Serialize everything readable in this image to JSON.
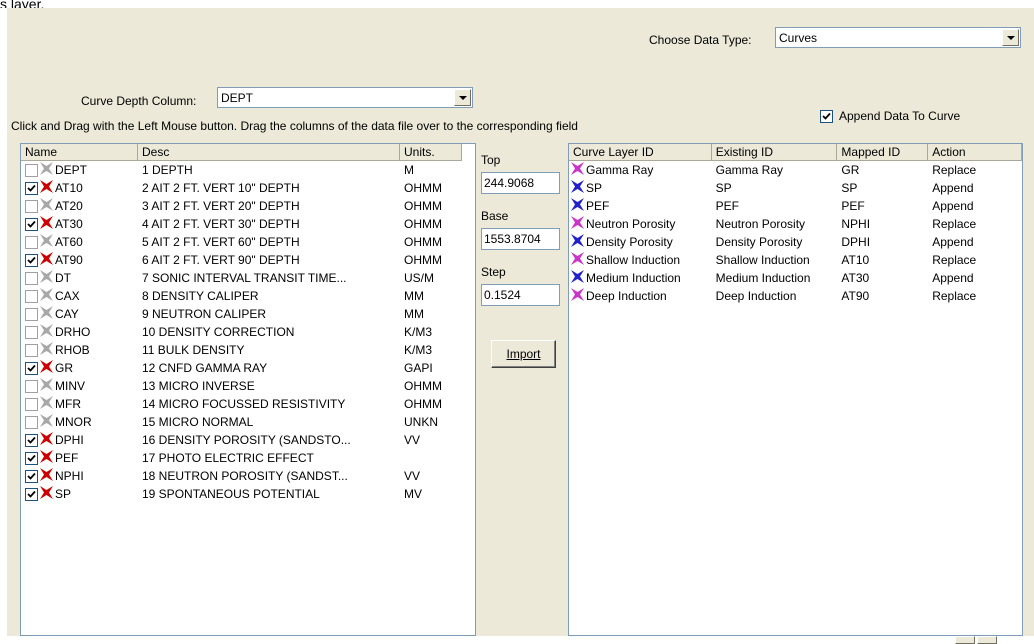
{
  "top_cut_text": "s layer.",
  "data_type": {
    "label": "Choose Data Type:",
    "value": "Curves"
  },
  "depth_column": {
    "label": "Curve Depth Column:",
    "value": "DEPT"
  },
  "append": {
    "label": "Append Data To Curve",
    "checked": true
  },
  "instructions": "Click and Drag with the Left Mouse button. Drag the columns of the data file over to the corresponding field",
  "source_list": {
    "headers": [
      "Name",
      "Desc",
      "Units."
    ],
    "rows": [
      {
        "checked": false,
        "icon": "grey-curve-icon",
        "name": "DEPT",
        "desc": "1 DEPTH",
        "units": "M"
      },
      {
        "checked": true,
        "icon": "red-curve-icon",
        "name": "AT10",
        "desc": "2 AIT 2 FT. VERT 10\" DEPTH",
        "units": "OHMM"
      },
      {
        "checked": false,
        "icon": "grey-curve-icon",
        "name": "AT20",
        "desc": "3 AIT 2 FT. VERT 20\" DEPTH",
        "units": "OHMM"
      },
      {
        "checked": true,
        "icon": "red-curve-icon",
        "name": "AT30",
        "desc": "4 AIT 2 FT. VERT 30\" DEPTH",
        "units": "OHMM"
      },
      {
        "checked": false,
        "icon": "grey-curve-icon",
        "name": "AT60",
        "desc": "5 AIT 2 FT. VERT 60\" DEPTH",
        "units": "OHMM"
      },
      {
        "checked": true,
        "icon": "red-curve-icon",
        "name": "AT90",
        "desc": "6 AIT 2 FT. VERT 90\" DEPTH",
        "units": "OHMM"
      },
      {
        "checked": false,
        "icon": "grey-curve-icon",
        "name": "DT",
        "desc": "7 SONIC INTERVAL TRANSIT TIME...",
        "units": "US/M"
      },
      {
        "checked": false,
        "icon": "grey-curve-icon",
        "name": "CAX",
        "desc": "8 DENSITY CALIPER",
        "units": "MM"
      },
      {
        "checked": false,
        "icon": "grey-curve-icon",
        "name": "CAY",
        "desc": "9 NEUTRON CALIPER",
        "units": "MM"
      },
      {
        "checked": false,
        "icon": "grey-curve-icon",
        "name": "DRHO",
        "desc": "10 DENSITY CORRECTION",
        "units": "K/M3"
      },
      {
        "checked": false,
        "icon": "grey-curve-icon",
        "name": "RHOB",
        "desc": "11 BULK DENSITY",
        "units": "K/M3"
      },
      {
        "checked": true,
        "icon": "red-curve-icon",
        "name": "GR",
        "desc": "12 CNFD GAMMA RAY",
        "units": "GAPI"
      },
      {
        "checked": false,
        "icon": "grey-curve-icon",
        "name": "MINV",
        "desc": "13 MICRO INVERSE",
        "units": "OHMM"
      },
      {
        "checked": false,
        "icon": "grey-curve-icon",
        "name": "MFR",
        "desc": "14 MICRO FOCUSSED RESISTIVITY",
        "units": "OHMM"
      },
      {
        "checked": false,
        "icon": "grey-curve-icon",
        "name": "MNOR",
        "desc": "15 MICRO NORMAL",
        "units": "UNKN"
      },
      {
        "checked": true,
        "icon": "red-curve-icon",
        "name": "DPHI",
        "desc": "16 DENSITY POROSITY (SANDSTO...",
        "units": "VV"
      },
      {
        "checked": true,
        "icon": "red-curve-icon",
        "name": "PEF",
        "desc": "17 PHOTO ELECTRIC EFFECT",
        "units": ""
      },
      {
        "checked": true,
        "icon": "red-curve-icon",
        "name": "NPHI",
        "desc": "18 NEUTRON POROSITY (SANDST...",
        "units": "VV"
      },
      {
        "checked": true,
        "icon": "red-curve-icon",
        "name": "SP",
        "desc": "19 SPONTANEOUS POTENTIAL",
        "units": "MV"
      }
    ]
  },
  "fields": {
    "top": {
      "label": "Top",
      "value": "244.9068"
    },
    "base": {
      "label": "Base",
      "value": "1553.8704"
    },
    "step": {
      "label": "Step",
      "value": "0.1524"
    },
    "import_label": "Import"
  },
  "mapping_list": {
    "headers": [
      "Curve Layer ID",
      "Existing ID",
      "Mapped ID",
      "Action"
    ],
    "rows": [
      {
        "color": "#cc33cc",
        "layer": "Gamma Ray",
        "existing": "Gamma Ray",
        "mapped": "GR",
        "action": "Replace"
      },
      {
        "color": "#2222cc",
        "layer": "SP",
        "existing": "SP",
        "mapped": "SP",
        "action": "Append"
      },
      {
        "color": "#2222cc",
        "layer": "PEF",
        "existing": "PEF",
        "mapped": "PEF",
        "action": "Append"
      },
      {
        "color": "#cc33cc",
        "layer": "Neutron Porosity",
        "existing": "Neutron Porosity",
        "mapped": "NPHI",
        "action": "Replace"
      },
      {
        "color": "#2222cc",
        "layer": "Density Porosity",
        "existing": "Density Porosity",
        "mapped": "DPHI",
        "action": "Append"
      },
      {
        "color": "#cc33cc",
        "layer": "Shallow Induction",
        "existing": "Shallow Induction",
        "mapped": "AT10",
        "action": "Replace"
      },
      {
        "color": "#2222cc",
        "layer": "Medium Induction",
        "existing": "Medium Induction",
        "mapped": "AT30",
        "action": "Append"
      },
      {
        "color": "#cc33cc",
        "layer": "Deep Induction",
        "existing": "Deep Induction",
        "mapped": "AT90",
        "action": "Replace"
      }
    ]
  },
  "colors": {
    "panel": "#ece9d8",
    "border": "#7f9db9",
    "red_icon": "#cc0000",
    "grey_icon": "#a8a8a8"
  }
}
